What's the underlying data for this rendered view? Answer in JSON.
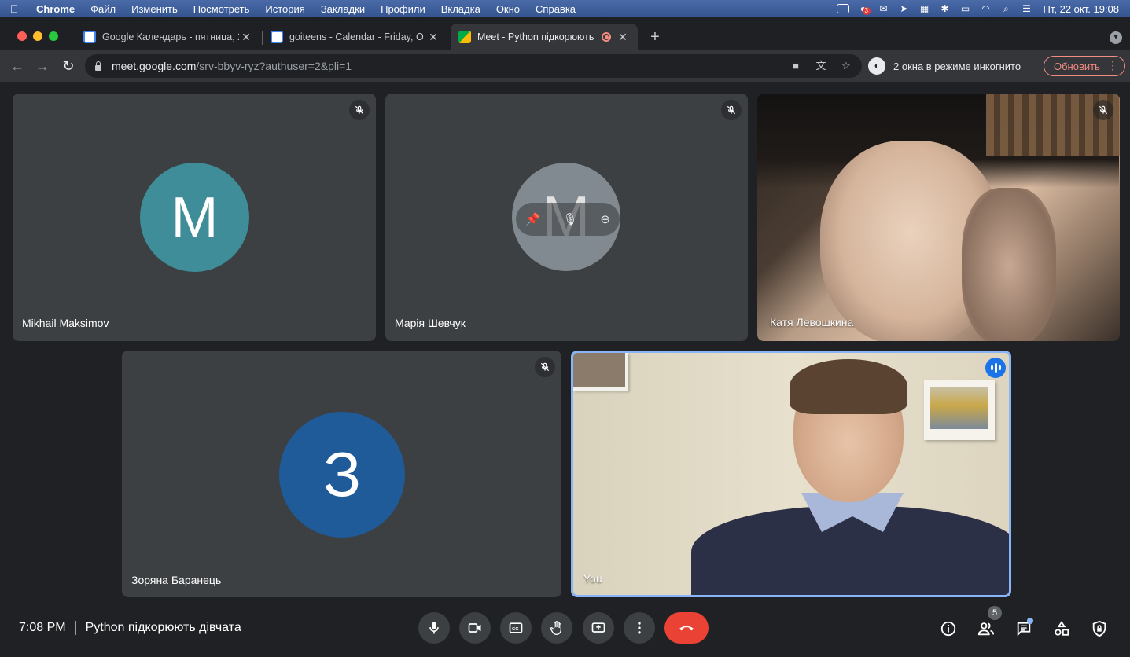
{
  "menubar": {
    "app": "Chrome",
    "items": [
      "Файл",
      "Изменить",
      "Посмотреть",
      "История",
      "Закладки",
      "Профили",
      "Вкладка",
      "Окно",
      "Справка"
    ],
    "badge_count": "3",
    "clock": "Пт, 22 окт.  19:08"
  },
  "tabs": [
    {
      "title": "Google Календарь - пятница, 2",
      "favicon_color": "#4285f4"
    },
    {
      "title": "goiteens - Calendar - Friday, O",
      "favicon_color": "#4285f4"
    },
    {
      "title": "Meet - Python підкорюють",
      "favicon_color": "#00ac47"
    }
  ],
  "toolbar": {
    "url_host": "meet.google.com",
    "url_path": "/srv-bbyv-ryz?authuser=2&pli=1",
    "incognito_label": "2 окна в режиме инкогнито",
    "update_label": "Обновить"
  },
  "participants": [
    {
      "name": "Mikhail Maksimov",
      "initial": "M",
      "color": "#3e8d99"
    },
    {
      "name": "Марія Шевчук",
      "initial": "M",
      "color": "#8e989e"
    },
    {
      "name": "Катя Левошкина"
    },
    {
      "name": "Зоряна Баранець",
      "initial": "З",
      "color": "#1f5a99"
    },
    {
      "name": "You"
    }
  ],
  "bottom": {
    "time": "7:08 PM",
    "meeting_title": "Python підкорюють дівчата",
    "participant_count": "5"
  },
  "colors": {
    "accent": "#8ab4f8",
    "end_call": "#ea4335",
    "tile_bg": "#3c4043",
    "page_bg": "#202124"
  }
}
